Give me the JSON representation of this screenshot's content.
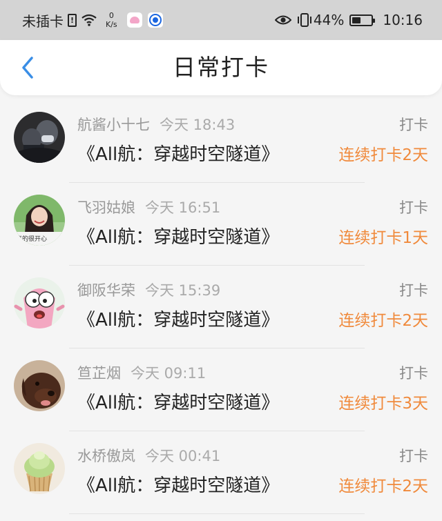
{
  "status_bar": {
    "carrier": "未插卡",
    "net_speed_value": "0",
    "net_speed_unit": "K/s",
    "battery": "44%",
    "battery_level": 0.44,
    "time": "10:16"
  },
  "header": {
    "title": "日常打卡"
  },
  "entries": [
    {
      "name": "航酱小十七",
      "time": "今天 18:43",
      "type": "打卡",
      "book": "《All航：穿越时空隧道》",
      "streak": "连续打卡2天"
    },
    {
      "name": "飞羽姑娘",
      "time": "今天 16:51",
      "type": "打卡",
      "book": "《All航：穿越时空隧道》",
      "streak": "连续打卡1天"
    },
    {
      "name": "御阪华荣",
      "time": "今天 15:39",
      "type": "打卡",
      "book": "《All航：穿越时空隧道》",
      "streak": "连续打卡2天"
    },
    {
      "name": "笪芷烟",
      "time": "今天 09:11",
      "type": "打卡",
      "book": "《All航：穿越时空隧道》",
      "streak": "连续打卡3天"
    },
    {
      "name": "水桥傲岚",
      "time": "今天 00:41",
      "type": "打卡",
      "book": "《All航：穿越时空隧道》",
      "streak": "连续打卡2天"
    }
  ],
  "avatar_text": "真的很开心",
  "colors": {
    "accent_blue": "#3a8ee6",
    "streak_orange": "#f08a3c",
    "status_bar_bg": "#d4d4d4"
  },
  "icons": [
    "chevron-left-icon",
    "sim-missing-icon",
    "wifi-icon",
    "eye-icon",
    "vibrate-icon",
    "battery-icon"
  ]
}
